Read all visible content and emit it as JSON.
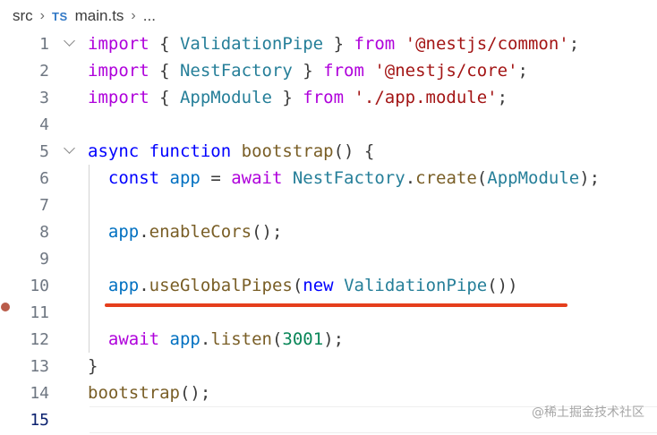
{
  "breadcrumb": {
    "folder": "src",
    "file_icon": "TS",
    "file": "main.ts",
    "more": "..."
  },
  "editor": {
    "language": "typescript",
    "active_line": 15,
    "breakpoint_line": 12,
    "lines": [
      {
        "num": "1",
        "fold": true,
        "tokens": [
          {
            "t": "import",
            "c": "kw"
          },
          {
            "t": " { ",
            "c": "pun"
          },
          {
            "t": "ValidationPipe",
            "c": "cls"
          },
          {
            "t": " } ",
            "c": "pun"
          },
          {
            "t": "from",
            "c": "kw"
          },
          {
            "t": " ",
            "c": "pun"
          },
          {
            "t": "'@nestjs/common'",
            "c": "str"
          },
          {
            "t": ";",
            "c": "pun"
          }
        ]
      },
      {
        "num": "2",
        "fold": false,
        "tokens": [
          {
            "t": "import",
            "c": "kw"
          },
          {
            "t": " { ",
            "c": "pun"
          },
          {
            "t": "NestFactory",
            "c": "cls"
          },
          {
            "t": " } ",
            "c": "pun"
          },
          {
            "t": "from",
            "c": "kw"
          },
          {
            "t": " ",
            "c": "pun"
          },
          {
            "t": "'@nestjs/core'",
            "c": "str"
          },
          {
            "t": ";",
            "c": "pun"
          }
        ]
      },
      {
        "num": "3",
        "fold": false,
        "tokens": [
          {
            "t": "import",
            "c": "kw"
          },
          {
            "t": " { ",
            "c": "pun"
          },
          {
            "t": "AppModule",
            "c": "cls"
          },
          {
            "t": " } ",
            "c": "pun"
          },
          {
            "t": "from",
            "c": "kw"
          },
          {
            "t": " ",
            "c": "pun"
          },
          {
            "t": "'./app.module'",
            "c": "str"
          },
          {
            "t": ";",
            "c": "pun"
          }
        ]
      },
      {
        "num": "4",
        "fold": false,
        "tokens": []
      },
      {
        "num": "5",
        "fold": true,
        "tokens": [
          {
            "t": "async",
            "c": "kw2"
          },
          {
            "t": " ",
            "c": "pun"
          },
          {
            "t": "function",
            "c": "kw2"
          },
          {
            "t": " ",
            "c": "pun"
          },
          {
            "t": "bootstrap",
            "c": "fn"
          },
          {
            "t": "() {",
            "c": "pun"
          }
        ]
      },
      {
        "num": "6",
        "fold": false,
        "tokens": [
          {
            "t": "  ",
            "c": "pun"
          },
          {
            "t": "const",
            "c": "kw2"
          },
          {
            "t": " ",
            "c": "pun"
          },
          {
            "t": "app",
            "c": "var"
          },
          {
            "t": " = ",
            "c": "pun"
          },
          {
            "t": "await",
            "c": "kw"
          },
          {
            "t": " ",
            "c": "pun"
          },
          {
            "t": "NestFactory",
            "c": "cls"
          },
          {
            "t": ".",
            "c": "pun"
          },
          {
            "t": "create",
            "c": "fn"
          },
          {
            "t": "(",
            "c": "pun"
          },
          {
            "t": "AppModule",
            "c": "cls"
          },
          {
            "t": ");",
            "c": "pun"
          }
        ]
      },
      {
        "num": "7",
        "fold": false,
        "tokens": []
      },
      {
        "num": "8",
        "fold": false,
        "tokens": [
          {
            "t": "  ",
            "c": "pun"
          },
          {
            "t": "app",
            "c": "var"
          },
          {
            "t": ".",
            "c": "pun"
          },
          {
            "t": "enableCors",
            "c": "fn"
          },
          {
            "t": "();",
            "c": "pun"
          }
        ]
      },
      {
        "num": "9",
        "fold": false,
        "tokens": []
      },
      {
        "num": "10",
        "fold": false,
        "tokens": [
          {
            "t": "  ",
            "c": "pun"
          },
          {
            "t": "app",
            "c": "var"
          },
          {
            "t": ".",
            "c": "pun"
          },
          {
            "t": "useGlobalPipes",
            "c": "fn"
          },
          {
            "t": "(",
            "c": "pun"
          },
          {
            "t": "new",
            "c": "kw2"
          },
          {
            "t": " ",
            "c": "pun"
          },
          {
            "t": "ValidationPipe",
            "c": "cls"
          },
          {
            "t": "())",
            "c": "pun"
          }
        ]
      },
      {
        "num": "11",
        "fold": false,
        "tokens": []
      },
      {
        "num": "12",
        "fold": false,
        "tokens": [
          {
            "t": "  ",
            "c": "pun"
          },
          {
            "t": "await",
            "c": "kw"
          },
          {
            "t": " ",
            "c": "pun"
          },
          {
            "t": "app",
            "c": "var"
          },
          {
            "t": ".",
            "c": "pun"
          },
          {
            "t": "listen",
            "c": "fn"
          },
          {
            "t": "(",
            "c": "pun"
          },
          {
            "t": "3001",
            "c": "num"
          },
          {
            "t": ");",
            "c": "pun"
          }
        ]
      },
      {
        "num": "13",
        "fold": false,
        "tokens": [
          {
            "t": "}",
            "c": "pun"
          }
        ]
      },
      {
        "num": "14",
        "fold": false,
        "tokens": [
          {
            "t": "bootstrap",
            "c": "fn"
          },
          {
            "t": "();",
            "c": "pun"
          }
        ]
      },
      {
        "num": "15",
        "fold": false,
        "tokens": []
      }
    ]
  },
  "annotation": {
    "underline_color": "#e53e1c",
    "underlined_line": 10
  },
  "watermark": "@稀土掘金技术社区",
  "colors": {
    "keyword_control": "#af00db",
    "keyword_storage": "#0000ff",
    "type": "#267f99",
    "function": "#795e26",
    "variable": "#0070c1",
    "string": "#a31515",
    "number": "#098658"
  }
}
